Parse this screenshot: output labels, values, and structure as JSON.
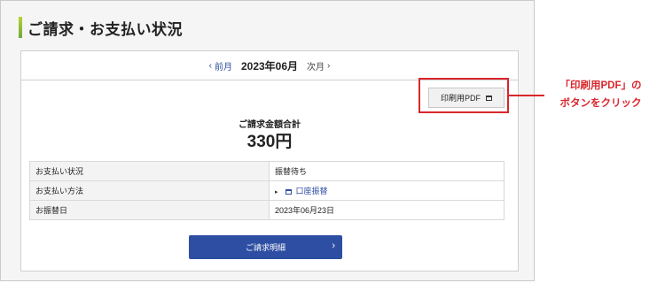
{
  "page": {
    "title": "ご請求・お支払い状況"
  },
  "month_nav": {
    "prev_label": "前月",
    "prev_arrow": "‹",
    "current_month": "2023年06月",
    "next_label": "次月",
    "next_arrow": "›"
  },
  "pdf_button": {
    "label": "印刷用PDF",
    "icon": "document-icon"
  },
  "billing": {
    "total_label": "ご請求金額合計",
    "total_amount": "330円"
  },
  "info_rows": [
    {
      "label": "お支払い状況",
      "value": "振替待ち"
    },
    {
      "label": "お支払い方法",
      "value": "口座振替",
      "marker": "▸",
      "icon": "bank-card-icon"
    },
    {
      "label": "お振替日",
      "value": "2023年06月23日"
    }
  ],
  "detail_button": {
    "label": "ご請求明細",
    "arrow": "›"
  },
  "annotation": {
    "line1": "「印刷用PDF」の",
    "line2": "ボタンをクリック",
    "color": "#d9262c"
  },
  "colors": {
    "accent": "#2d4ea3",
    "title_bar": "#8cc63f",
    "highlight": "#d9262c"
  }
}
